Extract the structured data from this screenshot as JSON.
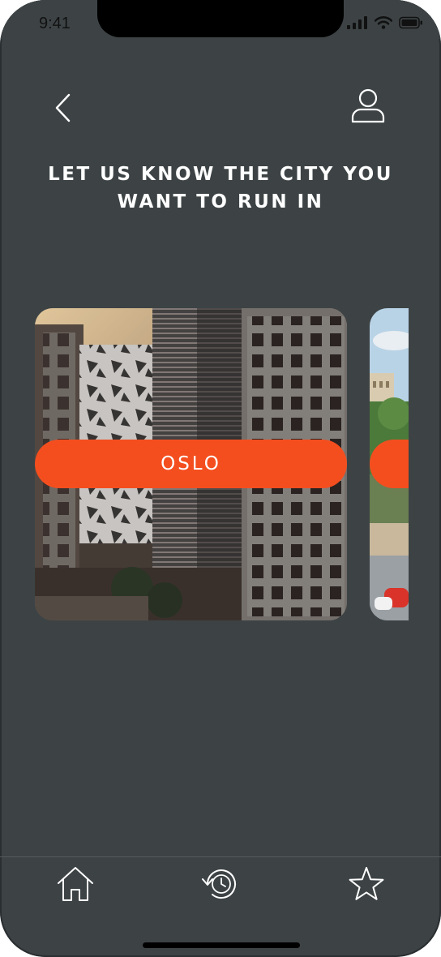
{
  "status_bar": {
    "time": "9:41"
  },
  "header": {
    "back_icon": "chevron-left-icon",
    "profile_icon": "user-icon",
    "title": "LET US KNOW THE CITY YOU WANT TO RUN IN"
  },
  "cities": [
    {
      "name": "OSLO"
    },
    {
      "name": ""
    }
  ],
  "tab_bar": {
    "items": [
      {
        "icon": "home-icon"
      },
      {
        "icon": "history-icon"
      },
      {
        "icon": "star-icon"
      }
    ]
  },
  "colors": {
    "background": "#3d4345",
    "accent": "#f44e1f",
    "text": "#ffffff"
  }
}
